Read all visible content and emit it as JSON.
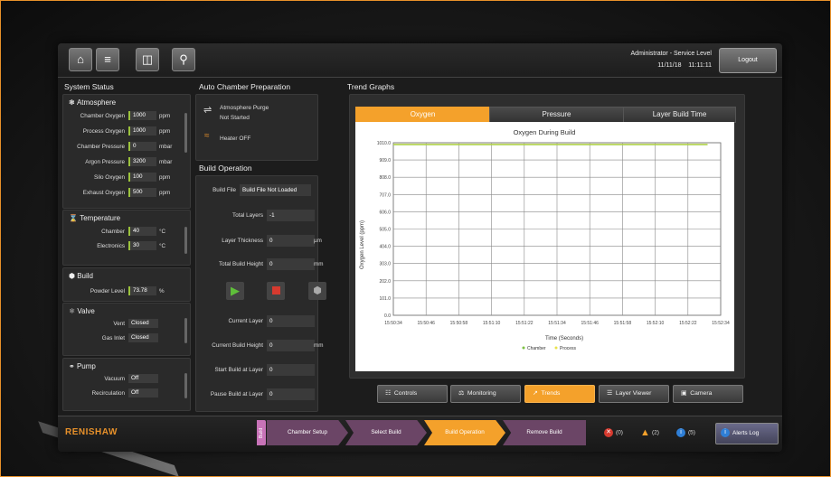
{
  "header": {
    "user_level": "Administrator - Service Level",
    "date": "11/11/18",
    "time": "11:11:11",
    "logout_label": "Logout"
  },
  "system_status": {
    "title": "System Status",
    "atmosphere": {
      "title": "Atmosphere",
      "rows": [
        {
          "label": "Chamber Oxygen",
          "value": "1000",
          "unit": "ppm"
        },
        {
          "label": "Process Oxygen",
          "value": "1000",
          "unit": "ppm"
        },
        {
          "label": "Chamber Pressure",
          "value": "0",
          "unit": "mbar"
        },
        {
          "label": "Argon Pressure",
          "value": "3200",
          "unit": "mbar"
        },
        {
          "label": "Silo Oxygen",
          "value": "100",
          "unit": "ppm"
        },
        {
          "label": "Exhaust Oxygen",
          "value": "500",
          "unit": "ppm"
        }
      ]
    },
    "temperature": {
      "title": "Temperature",
      "rows": [
        {
          "label": "Chamber",
          "value": "40",
          "unit": "°C"
        },
        {
          "label": "Electronics",
          "value": "30",
          "unit": "°C"
        }
      ]
    },
    "build": {
      "title": "Build",
      "rows": [
        {
          "label": "Powder Level",
          "value": "73.78",
          "unit": "%"
        }
      ]
    },
    "valve": {
      "title": "Valve",
      "rows": [
        {
          "label": "Vent",
          "value": "Closed"
        },
        {
          "label": "Gas Inlet",
          "value": "Closed"
        }
      ]
    },
    "pump": {
      "title": "Pump",
      "rows": [
        {
          "label": "Vacuum",
          "value": "Off"
        },
        {
          "label": "Recirculation",
          "value": "Off"
        }
      ]
    }
  },
  "auto_chamber": {
    "title": "Auto Chamber Preparation",
    "purge_label": "Atmosphere Purge",
    "purge_status": "Not Started",
    "heater_status": "Heater OFF"
  },
  "build_operation": {
    "title": "Build Operation",
    "build_file_label": "Build File",
    "build_file_value": "Build File Not Loaded",
    "total_layers_label": "Total Layers",
    "total_layers_value": "-1",
    "layer_thickness_label": "Layer Thickness",
    "layer_thickness_value": "0",
    "layer_thickness_unit": "µm",
    "total_height_label": "Total Build Height",
    "total_height_value": "0",
    "total_height_unit": "mm",
    "current_layer_label": "Current Layer",
    "current_layer_value": "0",
    "current_height_label": "Current Build Height",
    "current_height_value": "0",
    "current_height_unit": "mm",
    "start_layer_label": "Start Build at Layer",
    "start_layer_value": "0",
    "pause_layer_label": "Pause Build at Layer",
    "pause_layer_value": "0"
  },
  "trend": {
    "title": "Trend Graphs",
    "tabs": [
      "Oxygen",
      "Pressure",
      "Layer Build Time"
    ],
    "bottom_buttons": [
      "Controls",
      "Monitoring",
      "Trends",
      "Layer Viewer",
      "Camera"
    ]
  },
  "chart_data": {
    "type": "line",
    "title": "Oxygen During Build",
    "xlabel": "Time (Seconds)",
    "ylabel": "Oxygen Level (ppm)",
    "x_ticks": [
      "15:50:34",
      "15:50:46",
      "15:50:58",
      "15:51:10",
      "15:51:22",
      "15:51:34",
      "15:51:46",
      "15:51:58",
      "15:52:10",
      "15:52:22",
      "15:52:34"
    ],
    "y_ticks": [
      "0.0",
      "101.0",
      "202.0",
      "303.0",
      "404.0",
      "505.0",
      "606.0",
      "707.0",
      "808.0",
      "909.0",
      "1010.0"
    ],
    "ylim": [
      0,
      1010
    ],
    "series": [
      {
        "name": "Chamber",
        "color": "#7dc243",
        "x_start": 0,
        "x_end": 9.6,
        "value": 1000
      },
      {
        "name": "Process",
        "color": "#e8e24a",
        "x_start": 0,
        "x_end": 9.6,
        "value": 1000
      }
    ],
    "grid": true,
    "legend": "bottom"
  },
  "footer": {
    "logo": "RENISHAW",
    "build_tag": "Build",
    "steps": [
      "Chamber Setup",
      "Select Build",
      "Build Operation",
      "Remove Build"
    ],
    "errors_count": "(0)",
    "warnings_count": "(2)",
    "info_count": "(5)",
    "alerts_log_label": "Alerts Log"
  },
  "colors": {
    "accent": "#f4a12b",
    "step_purple": "#c873b8",
    "ok_green": "#9bc23c"
  }
}
